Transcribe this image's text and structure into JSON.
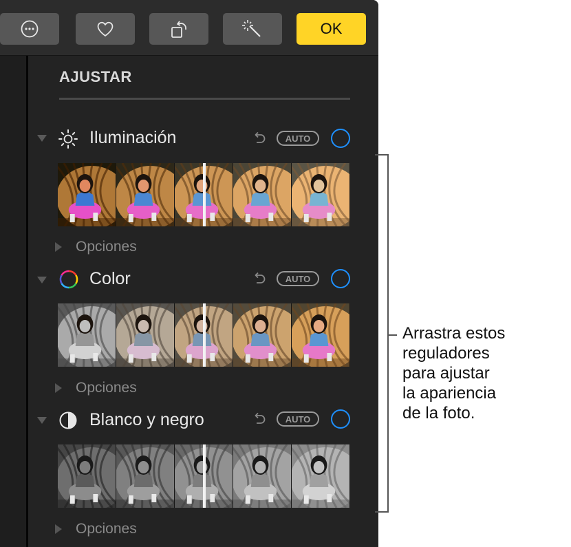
{
  "toolbar": {
    "buttons": [
      {
        "name": "more-button",
        "icon": "ellipsis-circle-icon"
      },
      {
        "name": "favorite-button",
        "icon": "heart-icon"
      },
      {
        "name": "rotate-button",
        "icon": "rotate-icon"
      },
      {
        "name": "enhance-button",
        "icon": "magic-wand-icon"
      }
    ],
    "ok_label": "OK"
  },
  "panel": {
    "title": "AJUSTAR",
    "sections": [
      {
        "label": "Iluminación",
        "icon": "sun-icon",
        "auto_label": "AUTO",
        "options_label": "Opciones",
        "slider_value": 0.5,
        "tone": "normal"
      },
      {
        "label": "Color",
        "icon": "color-wheel-icon",
        "auto_label": "AUTO",
        "options_label": "Opciones",
        "slider_value": 0.5,
        "tone": "desat-to-warm"
      },
      {
        "label": "Blanco y negro",
        "icon": "half-circle-icon",
        "auto_label": "AUTO",
        "options_label": "Opciones",
        "slider_value": 0.5,
        "tone": "grayscale"
      }
    ]
  },
  "callout": {
    "text_lines": [
      "Arrastra estos",
      "reguladores",
      "para ajustar",
      "la apariencia",
      "de la foto."
    ]
  },
  "colors": {
    "accent_blue": "#1e90ff",
    "ok_yellow": "#ffd426",
    "panel_bg": "#232323"
  }
}
